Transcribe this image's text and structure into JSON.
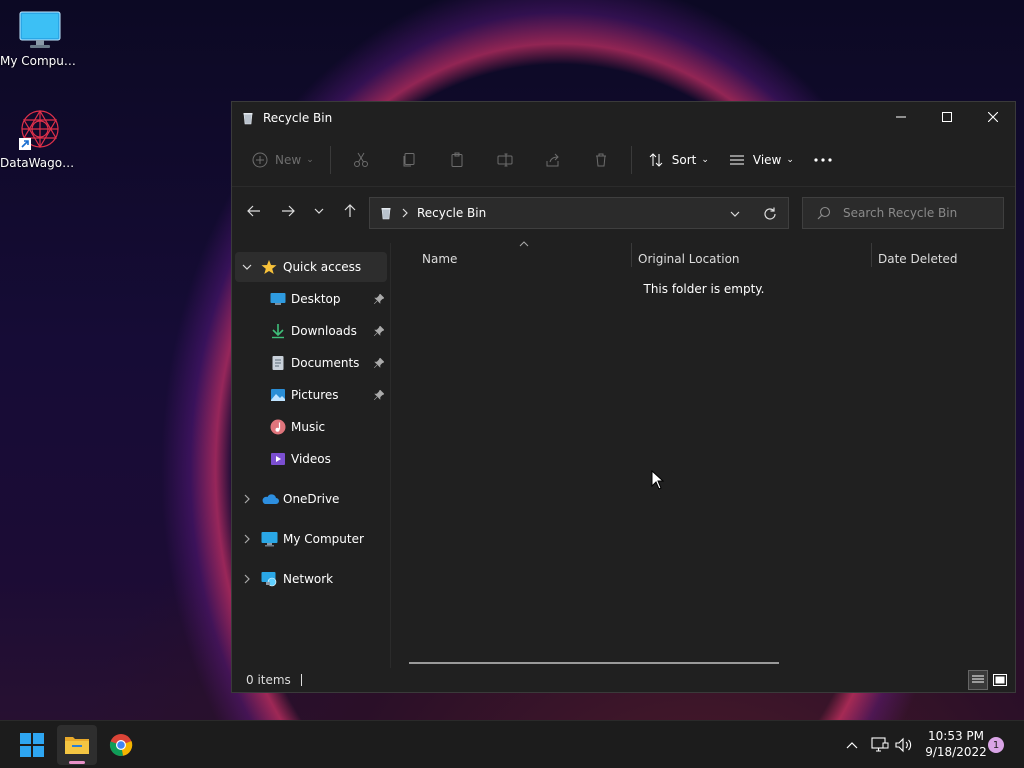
{
  "desktop": {
    "icons": [
      {
        "label": "My Computer"
      },
      {
        "label": "DataWagon..."
      }
    ]
  },
  "window": {
    "title": "Recycle Bin",
    "toolbar": {
      "new_label": "New",
      "sort_label": "Sort",
      "view_label": "View"
    },
    "address": {
      "path": "Recycle Bin"
    },
    "search": {
      "placeholder": "Search Recycle Bin"
    },
    "sidebar": {
      "quick_access": "Quick access",
      "items": [
        {
          "label": "Desktop",
          "pinned": true
        },
        {
          "label": "Downloads",
          "pinned": true
        },
        {
          "label": "Documents",
          "pinned": true
        },
        {
          "label": "Pictures",
          "pinned": true
        },
        {
          "label": "Music",
          "pinned": false
        },
        {
          "label": "Videos",
          "pinned": false
        }
      ],
      "onedrive": "OneDrive",
      "my_computer": "My Computer",
      "network": "Network"
    },
    "columns": [
      "Name",
      "Original Location",
      "Date Deleted"
    ],
    "empty_message": "This folder is empty.",
    "status": {
      "items": "0 items"
    }
  },
  "taskbar": {
    "time": "10:53 PM",
    "date": "9/18/2022",
    "notification_count": "1"
  },
  "colors": {
    "accent_blue": "#0078d4",
    "folder_yellow": "#f4c542",
    "window_bg": "#202020",
    "taskbar_bg": "#1c1c1c"
  }
}
